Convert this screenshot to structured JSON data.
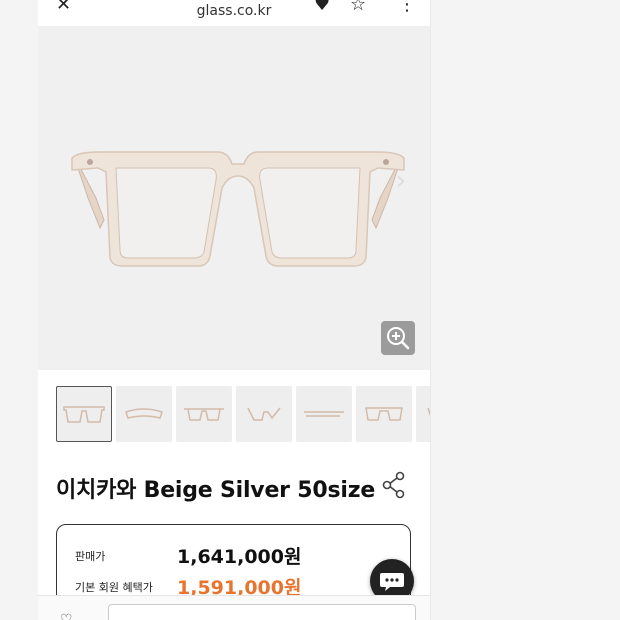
{
  "browser": {
    "url_text": "glass.co.kr"
  },
  "product": {
    "title": "이치카와 Beige Silver 50size",
    "image_count": 7
  },
  "pricing": {
    "sale_label": "판매가",
    "sale_price": "1,641,000원",
    "member_label": "기본 회원 혜택가",
    "member_price": "1,591,000원"
  },
  "colors": {
    "accent": "#e8752f",
    "frame": "#e9d9cc"
  },
  "icons": {
    "zoom": "zoom-in-icon",
    "share": "share-icon",
    "chat": "chat-icon",
    "next": "chevron-right-icon"
  }
}
